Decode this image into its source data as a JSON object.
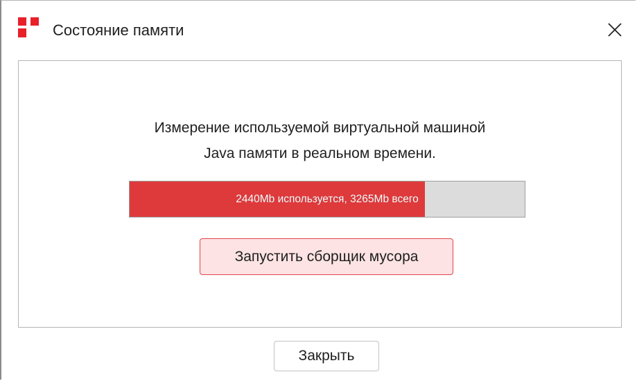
{
  "window": {
    "title": "Состояние памяти",
    "app_icon": "logo-icon",
    "close_icon": "close-icon",
    "accent_color": "#e8202a"
  },
  "content": {
    "description_line1": "Измерение используемой виртуальной машиной",
    "description_line2": "Java памяти в реальном времени."
  },
  "memory": {
    "used_mb": 2440,
    "total_mb": 3265,
    "usage_fraction": 0.747,
    "label": "2440Mb используется, 3265Mb всего",
    "fill_color": "#de3a3c",
    "track_color": "#dcdcdc"
  },
  "buttons": {
    "gc_label": "Запустить сборщик мусора",
    "close_label": "Закрыть"
  }
}
